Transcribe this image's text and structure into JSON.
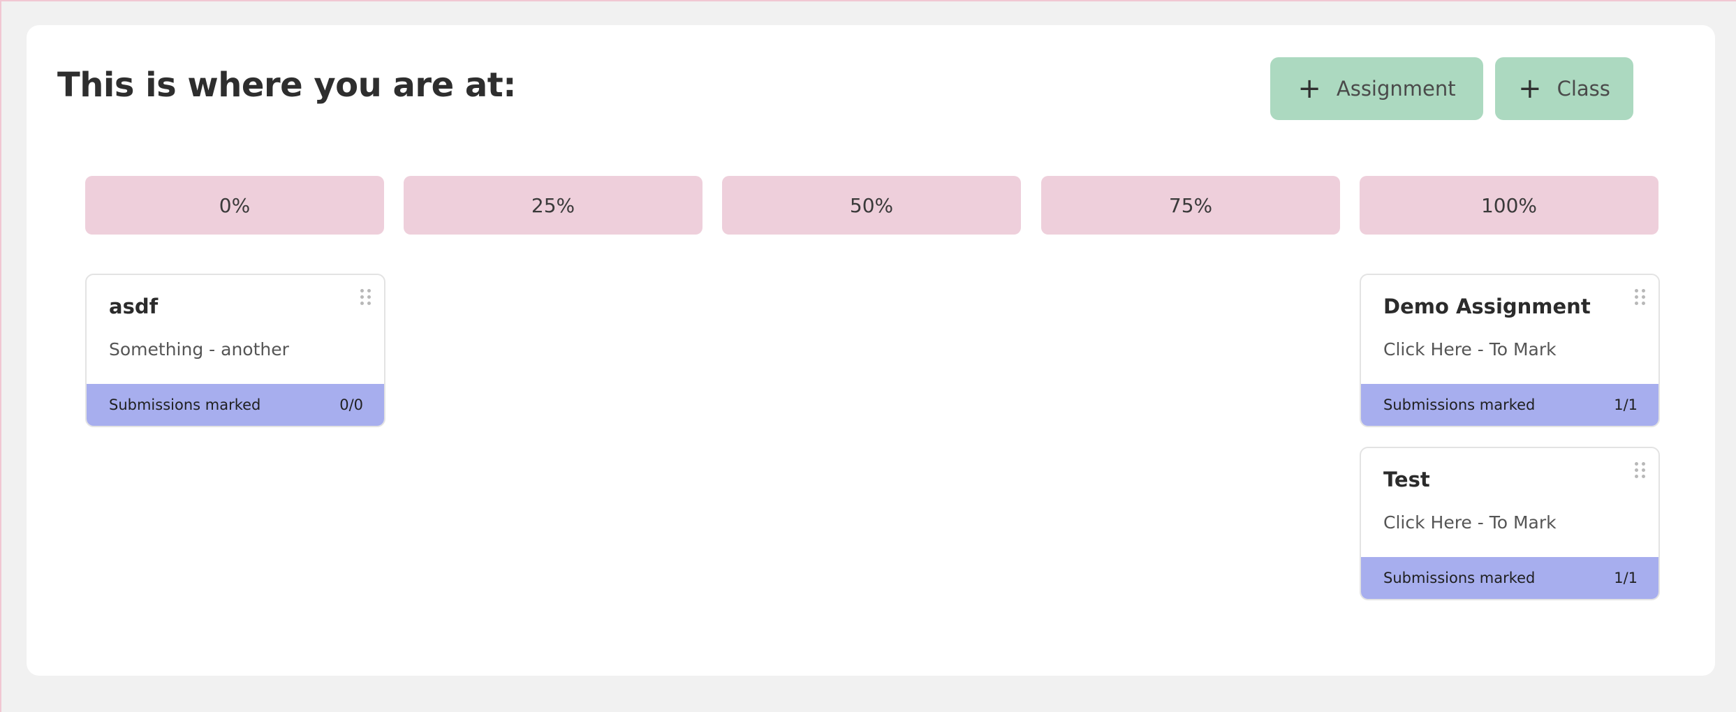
{
  "header": {
    "title": "This is where you are at:",
    "add_assignment_label": "Assignment",
    "add_class_label": "Class",
    "plus_icon": "plus-icon"
  },
  "columns": [
    {
      "label": "0%"
    },
    {
      "label": "25%"
    },
    {
      "label": "50%"
    },
    {
      "label": "75%"
    },
    {
      "label": "100%"
    }
  ],
  "cards": [
    {
      "column": "0%",
      "title": "asdf",
      "subtitle": "Something - another",
      "footer_label": "Submissions marked",
      "footer_count": "0/0"
    },
    {
      "column": "100%",
      "title": "Demo Assignment",
      "subtitle": "Click Here - To Mark",
      "footer_label": "Submissions marked",
      "footer_count": "1/1"
    },
    {
      "column": "100%",
      "title": "Test",
      "subtitle": "Click Here - To Mark",
      "footer_label": "Submissions marked",
      "footer_count": "1/1"
    }
  ],
  "colors": {
    "page_bg": "#f1f1f1",
    "panel_bg": "#ffffff",
    "button_bg": "#acd9c0",
    "column_header_bg": "#eecfdb",
    "card_footer_bg": "#a7aeee"
  }
}
